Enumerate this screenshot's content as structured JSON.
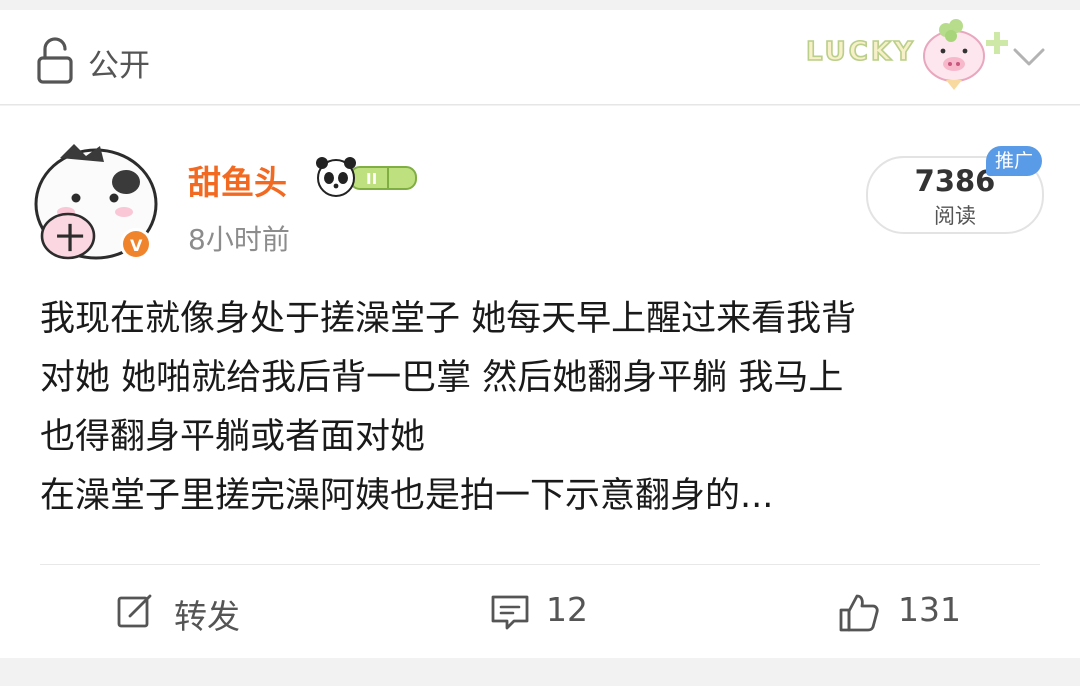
{
  "header": {
    "visibility_label": "公开",
    "badge_text": "LUCKY",
    "icons": [
      "lock-icon",
      "chevron-down-icon"
    ]
  },
  "post": {
    "author": "甜鱼头",
    "timestamp": "8小时前",
    "read_count": "7386",
    "read_label": "阅读",
    "promo_tag": "推广",
    "content_lines": [
      "我现在就像身处于搓澡堂子 她每天早上醒过来看我背",
      "对她 她啪就给我后背一巴掌 然后她翻身平躺 我马上",
      "也得翻身平躺或者面对她",
      "在澡堂子里搓完澡阿姨也是拍一下示意翻身的..."
    ],
    "verified_badge": "V",
    "level_badge": "II",
    "avatar_mark": "十"
  },
  "actions": {
    "repost_label": "转发",
    "comment_count": "12",
    "like_count": "131",
    "icons": [
      "edit-icon",
      "comment-icon",
      "thumbs-up-icon"
    ]
  },
  "colors": {
    "author": "#f26a21",
    "promo": "#5a9be8",
    "verified": "#f0842d"
  }
}
